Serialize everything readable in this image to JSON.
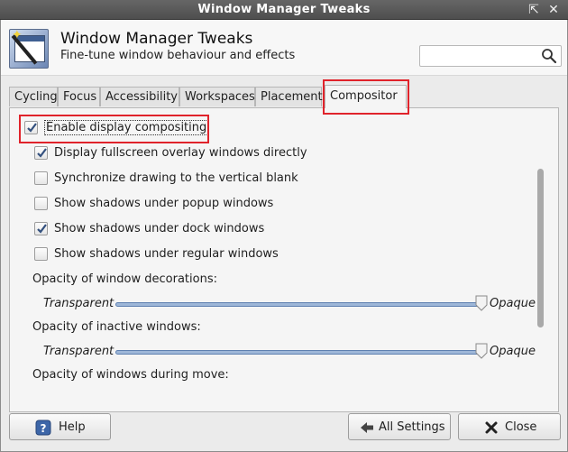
{
  "window": {
    "title": "Window Manager Tweaks"
  },
  "header": {
    "title": "Window Manager Tweaks",
    "subtitle": "Fine-tune window behaviour and effects",
    "search": {
      "value": "",
      "placeholder": ""
    }
  },
  "tabs": [
    {
      "label": "Cycling",
      "key": "C"
    },
    {
      "label": "Focus",
      "key": "F"
    },
    {
      "label": "Accessibility",
      "key": "A"
    },
    {
      "label": "Workspaces",
      "key": "W"
    },
    {
      "label": "Placement",
      "key": "P"
    },
    {
      "label": "Compositor",
      "key": "m",
      "active": true
    }
  ],
  "compositor": {
    "enable": {
      "label": "Enable display compositing",
      "checked": true
    },
    "options": [
      {
        "label": "Display fullscreen overlay windows directly",
        "checked": true
      },
      {
        "label": "Synchronize drawing to the vertical blank",
        "checked": false
      },
      {
        "label": "Show shadows under popup windows",
        "checked": false
      },
      {
        "label": "Show shadows under dock windows",
        "checked": true
      },
      {
        "label": "Show shadows under regular windows",
        "checked": false
      }
    ],
    "opacity": [
      {
        "label": "Opacity of window decorations:",
        "left": "Transparent",
        "right": "Opaque",
        "value": 1.0
      },
      {
        "label": "Opacity of inactive windows:",
        "left": "Transparent",
        "right": "Opaque",
        "value": 1.0
      },
      {
        "label": "Opacity of windows during move:"
      }
    ]
  },
  "buttons": {
    "help": "Help",
    "all_settings": "All Settings",
    "close": "Close"
  },
  "colors": {
    "accent": "#5e80b0",
    "highlight": "#e0232b"
  }
}
